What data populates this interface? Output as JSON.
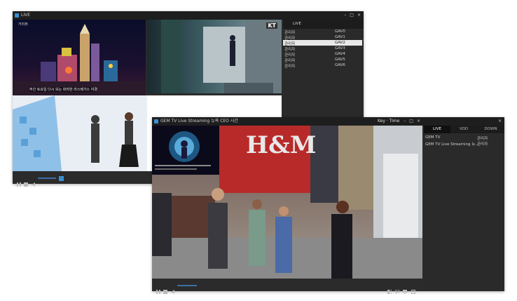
{
  "window1": {
    "title": "LIVE",
    "controls": {
      "minimize": "–",
      "maximize": "□",
      "close": "×"
    },
    "tile1_label": "거리뷰",
    "tile1_caption": "주간 토요일 다시 보는 화려한 라스베가스 야경",
    "tile2_badge": "KT",
    "panel": {
      "header": "LIVE",
      "rows": [
        {
          "name": "관리자",
          "id": "GAV0",
          "selected": false
        },
        {
          "name": "관리자",
          "id": "GAV1",
          "selected": false
        },
        {
          "name": "관리자",
          "id": "GAV2",
          "selected": true
        },
        {
          "name": "관리자",
          "id": "GAV3",
          "selected": false
        },
        {
          "name": "관리자",
          "id": "GAV4",
          "selected": false
        },
        {
          "name": "관리자",
          "id": "GAV5",
          "selected": false
        },
        {
          "name": "관리자",
          "id": "GAV6",
          "selected": false
        }
      ]
    }
  },
  "window2": {
    "title": "GEM TV Live Streaming 뉴욕 CEO 시간",
    "title_right": "Key · Time",
    "controls": {
      "minimize": "–",
      "maximize": "□",
      "close": "×"
    },
    "store_sign": "H&M",
    "panel": {
      "tabs": [
        "LIVE",
        "VOD",
        "DOWN"
      ],
      "rows": [
        {
          "name": "GEM TV",
          "status": "관리자"
        },
        {
          "name": "GEM TV Live Streaming 뉴...",
          "status": "관리자"
        }
      ]
    }
  },
  "colors": {
    "accent": "#3a8fd0",
    "selected_row": "#e8e8e8",
    "chrome": "#1e1e1e",
    "panel": "#2a2a2a"
  },
  "icons": [
    "play-icon",
    "stop-icon",
    "volume-icon",
    "split-view-icon",
    "chat-icon",
    "screen-icon",
    "fullscreen-icon"
  ]
}
